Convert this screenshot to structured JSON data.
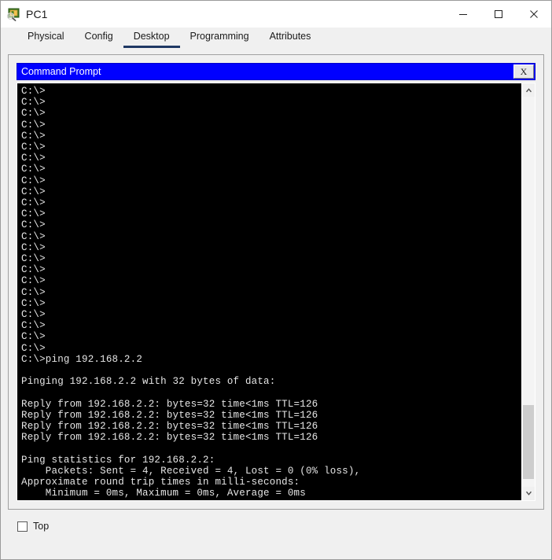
{
  "window": {
    "title": "PC1",
    "icon": "packet-tracer-device-icon",
    "controls": {
      "minimize": "—",
      "maximize": "☐",
      "close": "×"
    }
  },
  "tabs": [
    {
      "label": "Physical",
      "active": false
    },
    {
      "label": "Config",
      "active": false
    },
    {
      "label": "Desktop",
      "active": true
    },
    {
      "label": "Programming",
      "active": false
    },
    {
      "label": "Attributes",
      "active": false
    }
  ],
  "command_prompt": {
    "caption": "Command Prompt",
    "close_label": "X",
    "accent_color": "#0000ff",
    "background_color": "#000000",
    "text_color": "#e6e6e6",
    "lines": [
      "C:\\>",
      "C:\\>",
      "C:\\>",
      "C:\\>",
      "C:\\>",
      "C:\\>",
      "C:\\>",
      "C:\\>",
      "C:\\>",
      "C:\\>",
      "C:\\>",
      "C:\\>",
      "C:\\>",
      "C:\\>",
      "C:\\>",
      "C:\\>",
      "C:\\>",
      "C:\\>",
      "C:\\>",
      "C:\\>",
      "C:\\>",
      "C:\\>",
      "C:\\>",
      "C:\\>",
      "C:\\>ping 192.168.2.2",
      "",
      "Pinging 192.168.2.2 with 32 bytes of data:",
      "",
      "Reply from 192.168.2.2: bytes=32 time<1ms TTL=126",
      "Reply from 192.168.2.2: bytes=32 time<1ms TTL=126",
      "Reply from 192.168.2.2: bytes=32 time<1ms TTL=126",
      "Reply from 192.168.2.2: bytes=32 time<1ms TTL=126",
      "",
      "Ping statistics for 192.168.2.2:",
      "    Packets: Sent = 4, Received = 4, Lost = 0 (0% loss),",
      "Approximate round trip times in milli-seconds:",
      "    Minimum = 0ms, Maximum = 0ms, Average = 0ms",
      ""
    ],
    "prompt": "C:\\>",
    "scrollbar": {
      "up_arrow": "▲",
      "down_arrow": "▼",
      "thumb_position_percent": 79,
      "thumb_size_percent": 19
    }
  },
  "bottom": {
    "top_checkbox_label": "Top",
    "top_checkbox_checked": false
  }
}
